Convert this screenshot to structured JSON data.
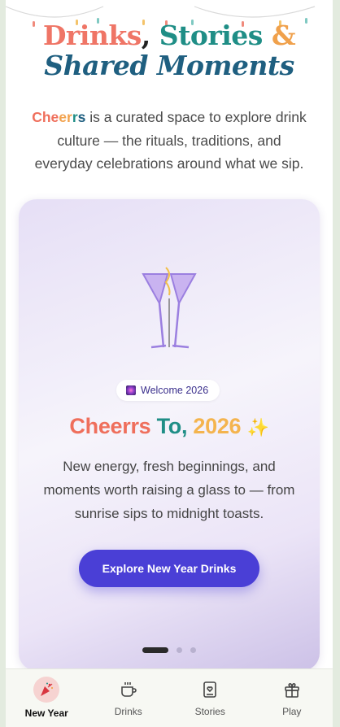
{
  "hero": {
    "line1_drinks": "Drinks",
    "line1_comma": ",",
    "line1_stories": "Stories",
    "line1_amp": "&",
    "line2": "Shared Moments"
  },
  "intro": {
    "brand_parts": [
      "Che",
      "er",
      "r",
      "s"
    ],
    "text": " is a curated space to explore drink culture — the rituals, traditions, and everyday celebrations around what we sip."
  },
  "slide": {
    "badge": "Welcome 2026",
    "heading_cheerrs": "Cheerrs",
    "heading_to": "To,",
    "heading_year": "2026",
    "heading_spark": "✨",
    "body": "New energy, fresh beginnings, and moments worth raising a glass to — from sunrise sips to midnight toasts.",
    "cta": "Explore New Year Drinks",
    "slide_count": 3,
    "active_slide": 1
  },
  "tabs": [
    {
      "label": "New Year",
      "icon": "party-popper-icon",
      "active": true
    },
    {
      "label": "Drinks",
      "icon": "coffee-cup-icon",
      "active": false
    },
    {
      "label": "Stories",
      "icon": "book-heart-icon",
      "active": false
    },
    {
      "label": "Play",
      "icon": "gift-icon",
      "active": false
    }
  ],
  "colors": {
    "accent": "#4a3fd6",
    "coral": "#ef6f5c",
    "teal": "#1f8e86",
    "orange": "#f0a14c",
    "navy": "#1f5f80"
  }
}
